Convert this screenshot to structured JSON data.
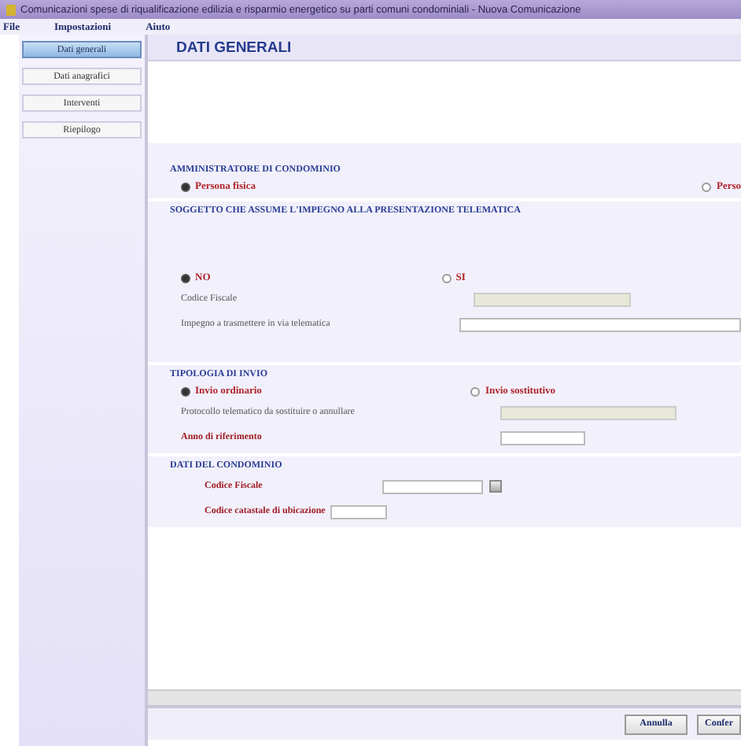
{
  "window": {
    "title": "Comunicazioni spese di riqualificazione edilizia e risparmio energetico su parti comuni condominiali - Nuova Comunicazione"
  },
  "menu": [
    "File",
    "Impostazioni",
    "Aiuto"
  ],
  "sidebar": {
    "items": [
      {
        "label": "Dati generali",
        "selected": true
      },
      {
        "label": "Dati anagrafici",
        "selected": false
      },
      {
        "label": "Interventi",
        "selected": false
      },
      {
        "label": "Riepilogo",
        "selected": false
      }
    ]
  },
  "page_title": "DATI GENERALI",
  "sections": [
    {
      "kind": "admin",
      "heading": "AMMINISTRATORE DI CONDOMINIO",
      "options": [
        {
          "label": "Persona fisica",
          "selected": true
        },
        {
          "label": "Perso",
          "selected": false
        }
      ]
    },
    {
      "kind": "subject",
      "heading": "SOGGETTO CHE ASSUME L'IMPEGNO ALLA PRESENTAZIONE TELEMATICA",
      "options": [
        {
          "label": "NO",
          "selected": true
        },
        {
          "label": "SI",
          "selected": false
        }
      ],
      "fields": [
        {
          "label": "Codice Fiscale",
          "required": false,
          "disabled": true
        },
        {
          "label": "Impegno a trasmettere in via telematica",
          "required": false,
          "disabled": false
        }
      ]
    },
    {
      "kind": "sending",
      "heading": "TIPOLOGIA DI INVIO",
      "options": [
        {
          "label": "Invio ordinario",
          "selected": true
        },
        {
          "label": "Invio sostitutivo",
          "selected": false
        }
      ],
      "fields": [
        {
          "label": "Protocollo telematico da sostituire o annullare",
          "required": false,
          "disabled": true
        },
        {
          "label": "Anno di riferimento",
          "required": true,
          "disabled": false
        }
      ]
    },
    {
      "kind": "building",
      "heading": "DATI DEL CONDOMINIO",
      "fields": [
        {
          "label": "Codice Fiscale",
          "required": true,
          "disabled": false,
          "lookup": true
        },
        {
          "label": "Codice catastale di ubicazione",
          "required": true,
          "disabled": false
        }
      ]
    }
  ],
  "buttons": [
    "Annulla",
    "Confer"
  ]
}
